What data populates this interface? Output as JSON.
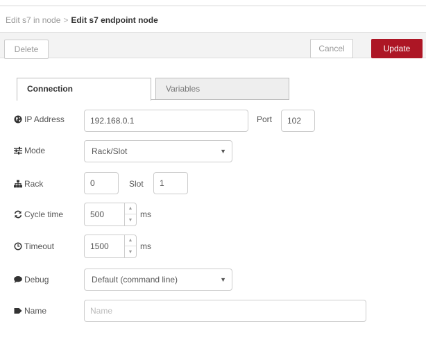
{
  "breadcrumb": {
    "previous": "Edit s7 in node",
    "separator": ">",
    "current": "Edit s7 endpoint node"
  },
  "toolbar": {
    "delete_label": "Delete",
    "cancel_label": "Cancel",
    "update_label": "Update"
  },
  "tabs": [
    {
      "label": "Connection",
      "active": true
    },
    {
      "label": "Variables",
      "active": false
    }
  ],
  "form": {
    "ip_address": {
      "label": "IP Address",
      "icon": "globe-icon",
      "value": "192.168.0.1"
    },
    "port": {
      "label": "Port",
      "value": "102"
    },
    "mode": {
      "label": "Mode",
      "icon": "sliders-icon",
      "value": "Rack/Slot"
    },
    "rack": {
      "label": "Rack",
      "icon": "sitemap-icon",
      "value": "0"
    },
    "slot": {
      "label": "Slot",
      "value": "1"
    },
    "cycle_time": {
      "label": "Cycle time",
      "icon": "refresh-icon",
      "value": "500",
      "unit": "ms"
    },
    "timeout": {
      "label": "Timeout",
      "icon": "clock-icon",
      "value": "1500",
      "unit": "ms"
    },
    "debug": {
      "label": "Debug",
      "icon": "comment-icon",
      "value": "Default (command line)"
    },
    "name": {
      "label": "Name",
      "icon": "tag-icon",
      "value": "",
      "placeholder": "Name"
    }
  },
  "colors": {
    "accent": "#ad1625",
    "toolbar_bg": "#f3f3f3",
    "inactive_tab_bg": "#eeeeee"
  }
}
